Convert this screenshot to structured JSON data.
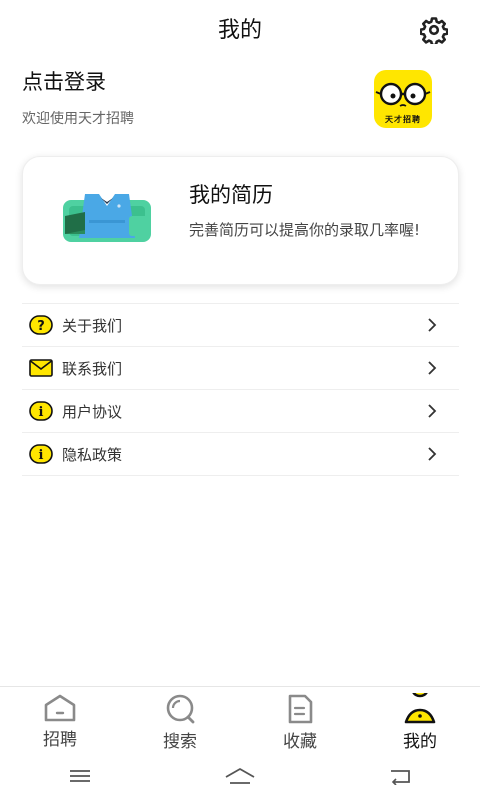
{
  "header": {
    "title": "我的"
  },
  "login": {
    "title": "点击登录",
    "subtitle": "欢迎使用天才招聘"
  },
  "logo": {
    "text": "天才招聘"
  },
  "resume": {
    "title": "我的简历",
    "description": "完善简历可以提高你的录取几率喔!"
  },
  "menu": {
    "items": [
      {
        "label": "关于我们",
        "icon": "question-icon"
      },
      {
        "label": "联系我们",
        "icon": "mail-icon"
      },
      {
        "label": "用户协议",
        "icon": "info-icon"
      },
      {
        "label": "隐私政策",
        "icon": "info-icon"
      }
    ]
  },
  "tabbar": {
    "items": [
      {
        "label": "招聘",
        "icon": "home-icon",
        "active": false
      },
      {
        "label": "搜索",
        "icon": "search-icon",
        "active": false
      },
      {
        "label": "收藏",
        "icon": "document-icon",
        "active": false
      },
      {
        "label": "我的",
        "icon": "person-icon",
        "active": true
      }
    ]
  },
  "colors": {
    "accent": "#ffe600",
    "icon_gray": "#999999",
    "resume_green": "#33c98a",
    "resume_blue": "#3fa9e0"
  }
}
